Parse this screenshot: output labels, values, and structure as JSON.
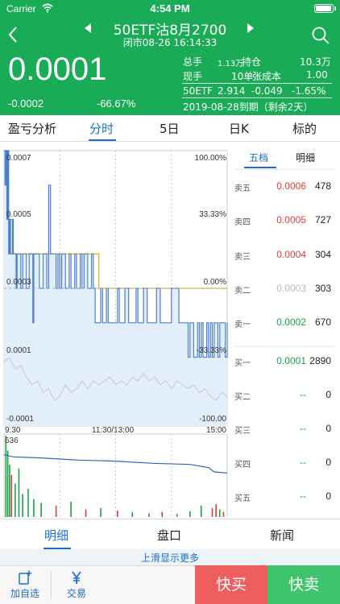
{
  "status_bar": {
    "carrier": "Carrier",
    "time": "4:54 PM"
  },
  "header": {
    "title": "50ETF沽8月2700",
    "subtitle": "闭市08-26 16:14:33",
    "price": "0.0001",
    "change": "-0.0002",
    "change_pct": "-66.67%",
    "stats": {
      "total_label": "总手",
      "total_value": "1.13万",
      "oi_label": "持仓",
      "oi_value": "10.3万",
      "current_label": "现手",
      "current_value": "10单",
      "cost_label": "张成本",
      "cost_value": "1.00"
    },
    "underlying": {
      "name": "50ETF",
      "price": "2.914",
      "change": "-0.049",
      "change_pct": "-1.65%"
    },
    "expiry": "2019-08-28到期（剩余2天）",
    "colors": {
      "background": "#1aab57"
    }
  },
  "tabs": [
    {
      "label": "盈亏分析",
      "active": false
    },
    {
      "label": "分时",
      "active": true
    },
    {
      "label": "5日",
      "active": false
    },
    {
      "label": "日K",
      "active": false
    },
    {
      "label": "标的",
      "active": false
    }
  ],
  "chart": {
    "y_labels": [
      "0.0007",
      "0.0005",
      "0.0003",
      "0.0001",
      "-0.0001"
    ],
    "pct_labels": [
      "100.00%",
      "33.33%",
      "0.00%",
      "-33.33%",
      "-100.00"
    ],
    "time_labels": [
      "9:30",
      "11:30/13:00",
      "15:00"
    ],
    "volume_max": "636"
  },
  "chart_data": {
    "type": "line",
    "price_axis": [
      -0.0001,
      0.0007
    ],
    "ref_price": 0.0003,
    "x_range": [
      0,
      240
    ],
    "series": [
      {
        "color": "#4a7fd4",
        "points": [
          [
            0,
            0.0007
          ],
          [
            1,
            0.0006
          ],
          [
            2,
            0.0007
          ],
          [
            3,
            0.0005
          ],
          [
            4,
            0.0007
          ],
          [
            5,
            0.0004
          ],
          [
            6,
            0.0005
          ],
          [
            7,
            0.0004
          ],
          [
            9,
            0.0005
          ],
          [
            10,
            0.0004
          ],
          [
            12,
            0.0004
          ],
          [
            13,
            0.0003
          ],
          [
            14,
            0.0004
          ],
          [
            16,
            0.0004
          ],
          [
            18,
            0.0003
          ],
          [
            20,
            0.0004
          ],
          [
            22,
            0.0004
          ],
          [
            24,
            0.0003
          ],
          [
            26,
            0.0003
          ],
          [
            27,
            0.0004
          ],
          [
            29,
            0.0004
          ],
          [
            31,
            0.0002
          ],
          [
            32,
            0.0004
          ],
          [
            36,
            0.0004
          ],
          [
            38,
            0.0003
          ],
          [
            42,
            0.0004
          ],
          [
            44,
            0.0004
          ],
          [
            46,
            0.0003
          ],
          [
            48,
            0.0006
          ],
          [
            50,
            0.0004
          ],
          [
            54,
            0.0004
          ],
          [
            56,
            0.0003
          ],
          [
            58,
            0.0004
          ],
          [
            60,
            0.0003
          ],
          [
            62,
            0.0004
          ],
          [
            64,
            0.0004
          ],
          [
            66,
            0.0003
          ],
          [
            70,
            0.0004
          ],
          [
            72,
            0.0003
          ],
          [
            76,
            0.0004
          ],
          [
            78,
            0.0003
          ],
          [
            82,
            0.0004
          ],
          [
            84,
            0.0003
          ],
          [
            86,
            0.0004
          ],
          [
            88,
            0.0004
          ],
          [
            90,
            0.0003
          ],
          [
            94,
            0.0004
          ],
          [
            96,
            0.0003
          ],
          [
            98,
            0.0002
          ],
          [
            102,
            0.0002
          ],
          [
            104,
            0.0003
          ],
          [
            106,
            0.0002
          ],
          [
            108,
            0.0002
          ],
          [
            110,
            0.0003
          ],
          [
            112,
            0.0002
          ],
          [
            120,
            0.0002
          ],
          [
            122,
            0.0003
          ],
          [
            124,
            0.0002
          ],
          [
            128,
            0.0002
          ],
          [
            130,
            0.0003
          ],
          [
            132,
            0.0003
          ],
          [
            134,
            0.0002
          ],
          [
            140,
            0.0002
          ],
          [
            142,
            0.0003
          ],
          [
            144,
            0.0002
          ],
          [
            148,
            0.0002
          ],
          [
            150,
            0.0003
          ],
          [
            152,
            0.0003
          ],
          [
            154,
            0.0002
          ],
          [
            160,
            0.0002
          ],
          [
            164,
            0.0003
          ],
          [
            166,
            0.0003
          ],
          [
            168,
            0.0002
          ],
          [
            176,
            0.0002
          ],
          [
            180,
            0.0003
          ],
          [
            184,
            0.0003
          ],
          [
            188,
            0.0002
          ],
          [
            196,
            0.0002
          ],
          [
            198,
            0.0001
          ],
          [
            200,
            0.0002
          ],
          [
            202,
            0.0002
          ],
          [
            204,
            0.0001
          ],
          [
            206,
            0.0001
          ],
          [
            208,
            0.0002
          ],
          [
            210,
            0.0001
          ],
          [
            212,
            0.0002
          ],
          [
            214,
            0.0001
          ],
          [
            216,
            0.0001
          ],
          [
            218,
            0.0002
          ],
          [
            220,
            0.0001
          ],
          [
            222,
            0.0002
          ],
          [
            224,
            0.0001
          ],
          [
            226,
            0.0002
          ],
          [
            228,
            0.0002
          ],
          [
            230,
            0.0001
          ],
          [
            232,
            0.0002
          ],
          [
            236,
            0.0002
          ],
          [
            238,
            0.0001
          ],
          [
            240,
            0.0002
          ]
        ]
      },
      {
        "color": "#e8b422",
        "points": [
          [
            0,
            0.0007
          ],
          [
            2,
            0.0006
          ],
          [
            4,
            0.0005
          ],
          [
            8,
            0.0005
          ],
          [
            10,
            0.0004
          ],
          [
            100,
            0.0004
          ],
          [
            102,
            0.0003
          ],
          [
            240,
            0.0003
          ]
        ]
      },
      {
        "color": "#c8c8c8",
        "points": [
          [
            0,
            0.0
          ],
          [
            6,
            0.01
          ],
          [
            12,
            -0.02
          ],
          [
            18,
            -0.01
          ],
          [
            24,
            -0.04
          ],
          [
            30,
            -0.06
          ],
          [
            36,
            -0.05
          ],
          [
            42,
            -0.08
          ],
          [
            48,
            -0.07
          ],
          [
            54,
            -0.1
          ],
          [
            60,
            -0.09
          ],
          [
            66,
            -0.06
          ],
          [
            72,
            -0.08
          ],
          [
            78,
            -0.07
          ],
          [
            84,
            -0.05
          ],
          [
            90,
            -0.07
          ],
          [
            96,
            -0.05
          ],
          [
            102,
            -0.06
          ],
          [
            108,
            -0.05
          ],
          [
            114,
            -0.04
          ],
          [
            120,
            -0.06
          ],
          [
            126,
            -0.05
          ],
          [
            132,
            -0.06
          ],
          [
            138,
            -0.04
          ],
          [
            144,
            -0.05
          ],
          [
            150,
            -0.03
          ],
          [
            156,
            -0.05
          ],
          [
            162,
            -0.04
          ],
          [
            168,
            -0.06
          ],
          [
            174,
            -0.05
          ],
          [
            180,
            -0.07
          ],
          [
            186,
            -0.05
          ],
          [
            192,
            -0.06
          ],
          [
            198,
            -0.07
          ],
          [
            204,
            -0.06
          ],
          [
            210,
            -0.08
          ],
          [
            216,
            -0.07
          ],
          [
            222,
            -0.09
          ],
          [
            228,
            -0.1
          ],
          [
            234,
            -0.08
          ],
          [
            240,
            -0.09
          ]
        ]
      }
    ],
    "volume": {
      "max": 636,
      "bars": [
        [
          2,
          636,
          "green"
        ],
        [
          4,
          520,
          "green"
        ],
        [
          6,
          410,
          "green"
        ],
        [
          8,
          330,
          "red"
        ],
        [
          12,
          260,
          "green"
        ],
        [
          16,
          380,
          "green"
        ],
        [
          20,
          180,
          "green"
        ],
        [
          26,
          220,
          "green"
        ],
        [
          32,
          140,
          "green"
        ],
        [
          40,
          110,
          "green"
        ],
        [
          56,
          90,
          "red"
        ],
        [
          72,
          120,
          "green"
        ],
        [
          88,
          60,
          "red"
        ],
        [
          104,
          70,
          "green"
        ],
        [
          122,
          50,
          "red"
        ],
        [
          138,
          40,
          "green"
        ],
        [
          156,
          30,
          "green"
        ],
        [
          170,
          40,
          "red"
        ],
        [
          186,
          25,
          "green"
        ],
        [
          200,
          45,
          "green"
        ],
        [
          212,
          90,
          "green"
        ],
        [
          224,
          70,
          "red"
        ],
        [
          228,
          100,
          "red"
        ],
        [
          232,
          60,
          "green"
        ],
        [
          236,
          40,
          "red"
        ]
      ],
      "oi_line": [
        [
          0,
          600
        ],
        [
          10,
          590
        ],
        [
          40,
          585
        ],
        [
          80,
          575
        ],
        [
          120,
          570
        ],
        [
          160,
          560
        ],
        [
          200,
          555
        ],
        [
          220,
          540
        ],
        [
          226,
          520
        ],
        [
          240,
          515
        ]
      ]
    }
  },
  "orderbook": {
    "tabs": [
      "五档",
      "明细"
    ],
    "sell": [
      {
        "label": "卖五",
        "price": "0.0006",
        "volume": "478",
        "color": "#e23b3b"
      },
      {
        "label": "卖四",
        "price": "0.0005",
        "volume": "727",
        "color": "#e23b3b"
      },
      {
        "label": "卖三",
        "price": "0.0004",
        "volume": "304",
        "color": "#e23b3b"
      },
      {
        "label": "卖二",
        "price": "0.0003",
        "volume": "303",
        "color": "#b8b8b8"
      },
      {
        "label": "卖一",
        "price": "0.0002",
        "volume": "670",
        "color": "#1aa34a"
      }
    ],
    "buy": [
      {
        "label": "买一",
        "price": "0.0001",
        "volume": "2890",
        "color": "#1aa34a"
      },
      {
        "label": "买二",
        "price": "--",
        "volume": "0",
        "color": "#1aa34a"
      },
      {
        "label": "买三",
        "price": "--",
        "volume": "0",
        "color": "#1aa34a"
      },
      {
        "label": "买四",
        "price": "--",
        "volume": "0",
        "color": "#1aa34a"
      },
      {
        "label": "买五",
        "price": "--",
        "volume": "0",
        "color": "#1aa34a"
      }
    ]
  },
  "bottom_tabs": [
    {
      "label": "明细",
      "active": true
    },
    {
      "label": "盘口",
      "active": false
    },
    {
      "label": "新闻",
      "active": false
    }
  ],
  "more_hint": "上滑显示更多",
  "toolbar": {
    "add_watch_label": "加自选",
    "trade_label": "交易",
    "buy_label": "快买",
    "sell_label": "快卖"
  }
}
